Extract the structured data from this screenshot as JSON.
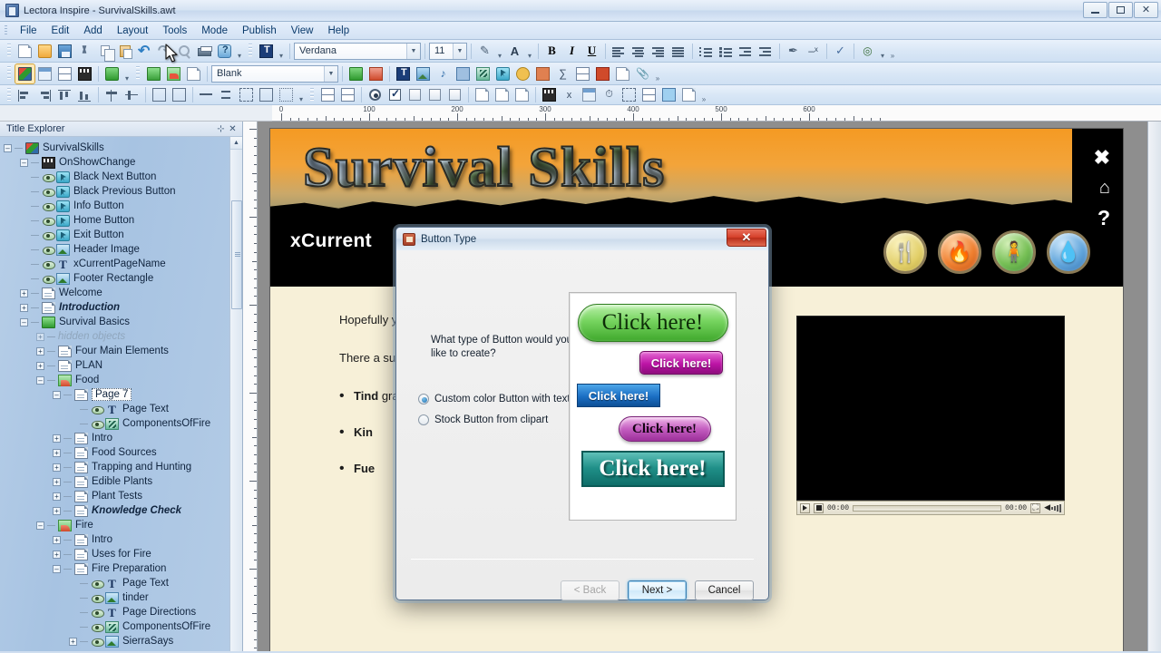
{
  "window": {
    "title": "Lectora Inspire - SurvivalSkills.awt",
    "app_icon": "document-icon",
    "minimize": "–",
    "maximize": "□",
    "close": "✕"
  },
  "menu": {
    "items": [
      "File",
      "Edit",
      "Add",
      "Layout",
      "Tools",
      "Mode",
      "Publish",
      "View",
      "Help"
    ]
  },
  "toolbars": {
    "row1": {
      "icons": [
        "new-document-icon",
        "open-folder-icon",
        "save-icon",
        "cut-icon",
        "copy-icon",
        "paste-icon",
        "undo-icon",
        "redo-icon",
        "find-icon",
        "print-icon",
        "help-balloon-icon"
      ],
      "text_tool_icon": "text-tool-icon",
      "font_name": "Verdana",
      "font_size": "11",
      "pencil_icon": "pencil-color-icon",
      "font_color_icon": "font-color-icon",
      "bold": "B",
      "italic": "I",
      "underline": "U",
      "align_icons": [
        "align-left-icon",
        "align-center-icon",
        "align-right-icon",
        "align-justify-icon"
      ],
      "list_icons": [
        "numbered-list-icon",
        "bulleted-list-icon",
        "decrease-indent-icon",
        "increase-indent-icon"
      ],
      "extra_icons": [
        "highlighter-icon",
        "superscript-icon",
        "spellcheck-icon",
        "hyperlink-icon"
      ]
    },
    "row2": {
      "mode_icons": [
        "title-view-icon",
        "chapter-view-icon",
        "page-view-icon",
        "preview-icon",
        "publish-web-icon"
      ],
      "object_icons": [
        "add-chapter-icon",
        "add-section-icon",
        "add-page-icon"
      ],
      "page_style": "Blank",
      "after_icons": [
        "import-icon",
        "export-pdf-icon"
      ]
    },
    "row3": {
      "align_group": [
        "align-left-obj-icon",
        "align-right-obj-icon",
        "align-top-obj-icon",
        "align-bottom-obj-icon"
      ],
      "center_group": [
        "center-horizontal-icon",
        "center-vertical-icon"
      ],
      "size_group": [
        "same-width-icon",
        "same-height-icon"
      ],
      "space_group": [
        "space-horizontal-icon",
        "space-vertical-icon",
        "group-icon",
        "ungroup-icon",
        "bring-front-icon"
      ],
      "form_group": [
        "table-icon",
        "form-icon",
        "radio-button-icon",
        "checkbox-icon",
        "entry-field-icon"
      ]
    }
  },
  "ruler": {
    "labels": [
      "0",
      "100",
      "200",
      "300",
      "400",
      "500",
      "600"
    ],
    "unit_spacing": 100
  },
  "explorer": {
    "title": "Title Explorer",
    "pin_icon": "pin-icon",
    "close_icon": "close-icon",
    "tree": [
      {
        "label": "SurvivalSkills",
        "icon": "title-icon",
        "depth": 0,
        "toggle": "minus",
        "eye": false,
        "style": "normal"
      },
      {
        "label": "OnShowChange",
        "icon": "action-icon",
        "depth": 1,
        "toggle": "minus",
        "eye": false,
        "style": "normal"
      },
      {
        "label": "Black Next Button",
        "icon": "button-icon",
        "depth": 1,
        "toggle": "none",
        "eye": true,
        "style": "normal"
      },
      {
        "label": "Black Previous Button",
        "icon": "button-icon",
        "depth": 1,
        "toggle": "none",
        "eye": true,
        "style": "normal"
      },
      {
        "label": "Info Button",
        "icon": "button-icon",
        "depth": 1,
        "toggle": "none",
        "eye": true,
        "style": "normal"
      },
      {
        "label": "Home Button",
        "icon": "button-icon",
        "depth": 1,
        "toggle": "none",
        "eye": true,
        "style": "normal"
      },
      {
        "label": "Exit Button",
        "icon": "button-icon",
        "depth": 1,
        "toggle": "none",
        "eye": true,
        "style": "normal"
      },
      {
        "label": "Header Image",
        "icon": "image-icon",
        "depth": 1,
        "toggle": "none",
        "eye": true,
        "style": "normal"
      },
      {
        "label": "xCurrentPageName",
        "icon": "text-icon",
        "depth": 1,
        "toggle": "none",
        "eye": true,
        "style": "normal"
      },
      {
        "label": "Footer Rectangle",
        "icon": "image-icon",
        "depth": 1,
        "toggle": "none",
        "eye": true,
        "style": "normal"
      },
      {
        "label": "Welcome",
        "icon": "page-icon",
        "depth": 1,
        "toggle": "plus",
        "eye": false,
        "style": "normal"
      },
      {
        "label": "Introduction",
        "icon": "page-icon",
        "depth": 1,
        "toggle": "plus",
        "eye": false,
        "style": "italic"
      },
      {
        "label": "Survival Basics",
        "icon": "chapter-icon",
        "depth": 1,
        "toggle": "minus",
        "eye": false,
        "style": "normal"
      },
      {
        "label": "hidden objects",
        "icon": "none",
        "depth": 2,
        "toggle": "plus-light",
        "eye": false,
        "style": "hidden"
      },
      {
        "label": "Four Main Elements",
        "icon": "page-icon",
        "depth": 2,
        "toggle": "plus",
        "eye": false,
        "style": "normal"
      },
      {
        "label": "PLAN",
        "icon": "page-icon",
        "depth": 2,
        "toggle": "plus",
        "eye": false,
        "style": "normal"
      },
      {
        "label": "Food",
        "icon": "section-icon",
        "depth": 2,
        "toggle": "minus",
        "eye": false,
        "style": "normal"
      },
      {
        "label": "Page 7",
        "icon": "page-icon",
        "depth": 3,
        "toggle": "minus",
        "eye": false,
        "style": "selected"
      },
      {
        "label": "Page Text",
        "icon": "text-icon",
        "depth": 4,
        "toggle": "none",
        "eye": true,
        "style": "normal"
      },
      {
        "label": "ComponentsOfFire",
        "icon": "animation-icon",
        "depth": 4,
        "toggle": "none",
        "eye": true,
        "style": "normal"
      },
      {
        "label": "Intro",
        "icon": "page-icon",
        "depth": 3,
        "toggle": "plus",
        "eye": false,
        "style": "normal"
      },
      {
        "label": "Food Sources",
        "icon": "page-icon",
        "depth": 3,
        "toggle": "plus",
        "eye": false,
        "style": "normal"
      },
      {
        "label": "Trapping and Hunting",
        "icon": "page-icon",
        "depth": 3,
        "toggle": "plus",
        "eye": false,
        "style": "normal"
      },
      {
        "label": "Edible Plants",
        "icon": "page-icon",
        "depth": 3,
        "toggle": "plus",
        "eye": false,
        "style": "normal"
      },
      {
        "label": "Plant Tests",
        "icon": "page-icon",
        "depth": 3,
        "toggle": "plus",
        "eye": false,
        "style": "normal"
      },
      {
        "label": "Knowledge Check",
        "icon": "page-icon",
        "depth": 3,
        "toggle": "plus",
        "eye": false,
        "style": "italic"
      },
      {
        "label": "Fire",
        "icon": "section-icon",
        "depth": 2,
        "toggle": "minus",
        "eye": false,
        "style": "normal"
      },
      {
        "label": "Intro",
        "icon": "page-icon",
        "depth": 3,
        "toggle": "plus",
        "eye": false,
        "style": "normal"
      },
      {
        "label": "Uses for Fire",
        "icon": "page-icon",
        "depth": 3,
        "toggle": "plus",
        "eye": false,
        "style": "normal"
      },
      {
        "label": "Fire Preparation",
        "icon": "page-icon",
        "depth": 3,
        "toggle": "minus",
        "eye": false,
        "style": "normal"
      },
      {
        "label": "Page Text",
        "icon": "text-icon",
        "depth": 4,
        "toggle": "none",
        "eye": true,
        "style": "normal"
      },
      {
        "label": "tinder",
        "icon": "image-icon",
        "depth": 4,
        "toggle": "none",
        "eye": true,
        "style": "normal"
      },
      {
        "label": "Page Directions",
        "icon": "text-icon",
        "depth": 4,
        "toggle": "none",
        "eye": true,
        "style": "normal"
      },
      {
        "label": "ComponentsOfFire",
        "icon": "animation-icon",
        "depth": 4,
        "toggle": "none",
        "eye": true,
        "style": "normal"
      },
      {
        "label": "SierraSays",
        "icon": "image-icon",
        "depth": 4,
        "toggle": "plus",
        "eye": true,
        "style": "normal"
      }
    ],
    "scroll_up": "▲",
    "scroll_down": "▼"
  },
  "page": {
    "banner_title": "Survival Skills",
    "page_name": "xCurrent",
    "nav_icons": [
      {
        "name": "close-icon",
        "glyph": "✖"
      },
      {
        "name": "home-icon",
        "glyph": "⌂"
      },
      {
        "name": "help-icon",
        "glyph": "?"
      }
    ],
    "category_icons": [
      {
        "name": "food-category-icon",
        "glyph": "🍴",
        "color": "#e2cf68"
      },
      {
        "name": "fire-category-icon",
        "glyph": "🔥",
        "color": "#ef8030"
      },
      {
        "name": "shelter-category-icon",
        "glyph": "🧍",
        "color": "#76bf55"
      },
      {
        "name": "water-category-icon",
        "glyph": "💧",
        "color": "#62a6dc"
      }
    ],
    "body": {
      "para1": "Hopefully you. Th other k items t to get",
      "para2": "There a succes",
      "bullets": [
        {
          "bold": "Tind",
          "rest": "gras to b"
        },
        {
          "bold": "Kin",
          "rest": ""
        },
        {
          "bold": "Fue",
          "rest": ""
        }
      ]
    },
    "video": {
      "play_icon": "play-icon",
      "stop_icon": "stop-icon",
      "time_current": "00:00",
      "time_total": "00:00",
      "fullscreen_icon": "fullscreen-icon",
      "volume_icon": "volume-icon"
    }
  },
  "dialog": {
    "title": "Button Type",
    "title_icon": "button-wizard-icon",
    "close_label": "✕",
    "question": "What type of Button would you like to create?",
    "options": [
      {
        "label": "Custom color Button with text",
        "selected": true
      },
      {
        "label": "Stock Button from clipart",
        "selected": false
      }
    ],
    "previews": [
      {
        "label": "Click here!",
        "style": "green-rounded"
      },
      {
        "label": "Click here!",
        "style": "magenta-small"
      },
      {
        "label": "Click here!",
        "style": "blue-rect"
      },
      {
        "label": "Click here!",
        "style": "pink-pill"
      },
      {
        "label": "Click here!",
        "style": "teal-block"
      }
    ],
    "buttons": {
      "back": "< Back",
      "next": "Next >",
      "cancel": "Cancel"
    }
  }
}
